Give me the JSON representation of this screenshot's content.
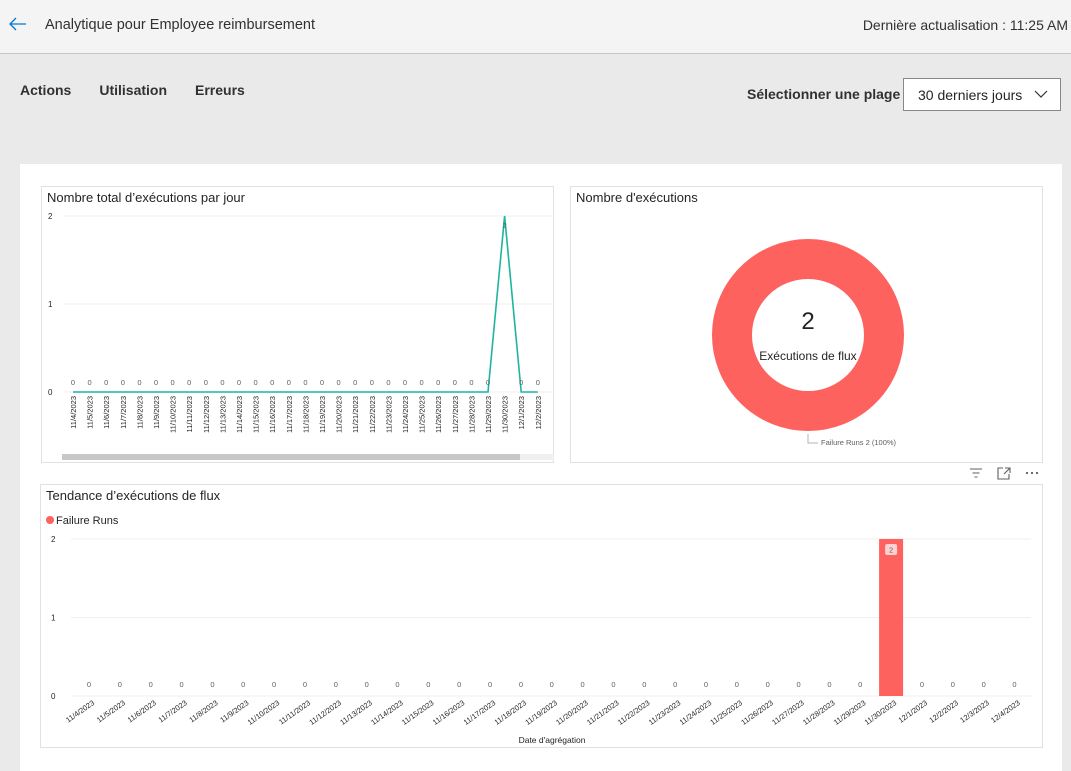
{
  "header": {
    "back_icon": "arrow-left-icon",
    "title": "Analytique pour Employee reimbursement",
    "last_refresh": "Dernière actualisation : 11:25 AM"
  },
  "tabs": [
    {
      "label": "Actions"
    },
    {
      "label": "Utilisation"
    },
    {
      "label": "Erreurs"
    }
  ],
  "range": {
    "label": "Sélectionner une plage",
    "selected": "30 derniers jours",
    "chevron_icon": "chevron-down-icon"
  },
  "colors": {
    "line": "#1fb4a0",
    "failure": "#fd625e",
    "accent": "#0078d4"
  },
  "visual_header": {
    "filter_icon": "filter-icon",
    "focus_icon": "focus-mode-icon",
    "more_icon": "more-options-icon"
  },
  "chart_data": [
    {
      "type": "line",
      "title": "Nombre total d’exécutions par jour",
      "xlabel": "",
      "ylabel": "",
      "ylim": [
        0,
        2
      ],
      "yticks": [
        "0",
        "1",
        "2"
      ],
      "grid": true,
      "categories": [
        "11/4/2023",
        "11/5/2023",
        "11/6/2023",
        "11/7/2023",
        "11/8/2023",
        "11/9/2023",
        "11/10/2023",
        "11/11/2023",
        "11/12/2023",
        "11/13/2023",
        "11/14/2023",
        "11/15/2023",
        "11/16/2023",
        "11/17/2023",
        "11/18/2023",
        "11/19/2023",
        "11/20/2023",
        "11/21/2023",
        "11/22/2023",
        "11/23/2023",
        "11/24/2023",
        "11/25/2023",
        "11/26/2023",
        "11/27/2023",
        "11/28/2023",
        "11/29/2023",
        "11/30/2023",
        "12/1/2023",
        "12/2/2023"
      ],
      "values": [
        0,
        0,
        0,
        0,
        0,
        0,
        0,
        0,
        0,
        0,
        0,
        0,
        0,
        0,
        0,
        0,
        0,
        0,
        0,
        0,
        0,
        0,
        0,
        0,
        0,
        0,
        2,
        0,
        0
      ]
    },
    {
      "type": "pie",
      "title": "Nombre d'exécutions",
      "center_value": "2",
      "center_label": "Exécutions de flux",
      "slices": [
        {
          "name": "Failure Runs",
          "value": 2,
          "percent": 100,
          "label": "Failure Runs 2 (100%)"
        }
      ]
    },
    {
      "type": "bar",
      "title": "Tendance d’exécutions de flux",
      "legend": [
        {
          "name": "Failure Runs"
        }
      ],
      "legend_position": "top-left",
      "xlabel": "Date d'agrégation",
      "ylabel": "",
      "ylim": [
        0,
        2
      ],
      "yticks": [
        "0",
        "1",
        "2"
      ],
      "grid": true,
      "categories": [
        "11/4/2023",
        "11/5/2023",
        "11/6/2023",
        "11/7/2023",
        "11/8/2023",
        "11/9/2023",
        "11/10/2023",
        "11/11/2023",
        "11/12/2023",
        "11/13/2023",
        "11/14/2023",
        "11/15/2023",
        "11/16/2023",
        "11/17/2023",
        "11/18/2023",
        "11/19/2023",
        "11/20/2023",
        "11/21/2023",
        "11/22/2023",
        "11/23/2023",
        "11/24/2023",
        "11/25/2023",
        "11/26/2023",
        "11/27/2023",
        "11/28/2023",
        "11/29/2023",
        "11/30/2023",
        "12/1/2023",
        "12/2/2023",
        "12/3/2023",
        "12/4/2023"
      ],
      "series": [
        {
          "name": "Failure Runs",
          "values": [
            0,
            0,
            0,
            0,
            0,
            0,
            0,
            0,
            0,
            0,
            0,
            0,
            0,
            0,
            0,
            0,
            0,
            0,
            0,
            0,
            0,
            0,
            0,
            0,
            0,
            0,
            2,
            0,
            0,
            0,
            0
          ]
        }
      ]
    }
  ]
}
